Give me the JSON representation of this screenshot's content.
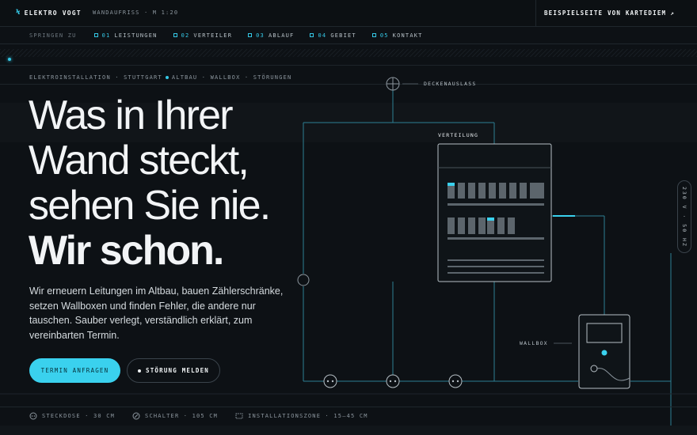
{
  "header": {
    "brand": "ELEKTRO VOGT",
    "subtitle": "WANDAUFRISS · M 1:20",
    "external_link": "BEISPIELSEITE VON KARTEDIEM"
  },
  "nav": {
    "label": "SPRINGEN ZU",
    "items": [
      {
        "num": "01",
        "label": "LEISTUNGEN"
      },
      {
        "num": "02",
        "label": "VERTEILER"
      },
      {
        "num": "03",
        "label": "ABLAUF"
      },
      {
        "num": "04",
        "label": "GEBIET"
      },
      {
        "num": "05",
        "label": "KONTAKT"
      }
    ]
  },
  "hero": {
    "crumbs_a": "ELEKTROINSTALLATION · STUTTGART",
    "crumbs_b": "ALTBAU · WALLBOX · STÖRUNGEN",
    "headline": [
      "Was in Ihrer",
      "Wand steckt,",
      "sehen Sie nie."
    ],
    "headline_strong": "Wir schon.",
    "lead": "Wir erneuern Leitungen im Altbau, bauen Zählerschränke, setzen Wallboxen und finden Fehler, die andere nur tauschen. Sauber verlegt, verständlich erklärt, zum vereinbarten Termin.",
    "cta_primary": "TERMIN ANFRAGEN",
    "cta_secondary": "STÖRUNG MELDEN"
  },
  "diagram": {
    "ceiling_label": "DECKENAUSLASS",
    "panel_label": "VERTEILUNG",
    "wallbox_label": "WALLBOX",
    "voltage": "230 V · 50 HZ"
  },
  "legend": [
    {
      "icon": "socket-icon",
      "label": "STECKDOSE · 30 CM"
    },
    {
      "icon": "switch-icon",
      "label": "SCHALTER · 105 CM"
    },
    {
      "icon": "zone-icon",
      "label": "INSTALLATIONSZONE · 15–45 CM"
    }
  ],
  "colors": {
    "accent": "#3ad1ee",
    "background": "#0d1115"
  }
}
